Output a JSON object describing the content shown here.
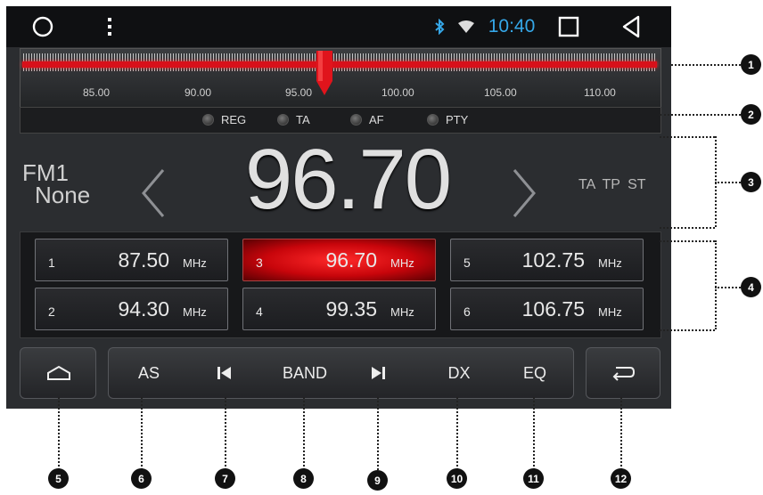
{
  "status_bar": {
    "time": "10:40",
    "icons": [
      "circle-home-icon",
      "more-vert-icon",
      "bluetooth-icon",
      "wifi-icon",
      "square-recents-icon",
      "triangle-back-icon"
    ]
  },
  "scale": {
    "labels": [
      "85.00",
      "90.00",
      "95.00",
      "100.00",
      "105.00",
      "110.00"
    ],
    "tuned_mhz": 96.7
  },
  "indicators": [
    "REG",
    "TA",
    "AF",
    "PTY"
  ],
  "main": {
    "band": "FM1",
    "ps_name": "None",
    "frequency": "96.70",
    "flags": "TA TP ST"
  },
  "presets": [
    {
      "num": "1",
      "freq": "87.50",
      "unit": "MHz",
      "selected": false
    },
    {
      "num": "3",
      "freq": "96.70",
      "unit": "MHz",
      "selected": true
    },
    {
      "num": "5",
      "freq": "102.75",
      "unit": "MHz",
      "selected": false
    },
    {
      "num": "2",
      "freq": "94.30",
      "unit": "MHz",
      "selected": false
    },
    {
      "num": "4",
      "freq": "99.35",
      "unit": "MHz",
      "selected": false
    },
    {
      "num": "6",
      "freq": "106.75",
      "unit": "MHz",
      "selected": false
    }
  ],
  "controls": {
    "as": "AS",
    "band": "BAND",
    "dx": "DX",
    "eq": "EQ"
  },
  "callouts": [
    "1",
    "2",
    "3",
    "4",
    "5",
    "6",
    "7",
    "8",
    "9",
    "10",
    "11",
    "12"
  ],
  "colors": {
    "accent_red": "#d8101a",
    "time_blue": "#35a7e8",
    "background": "#2b2d30"
  }
}
